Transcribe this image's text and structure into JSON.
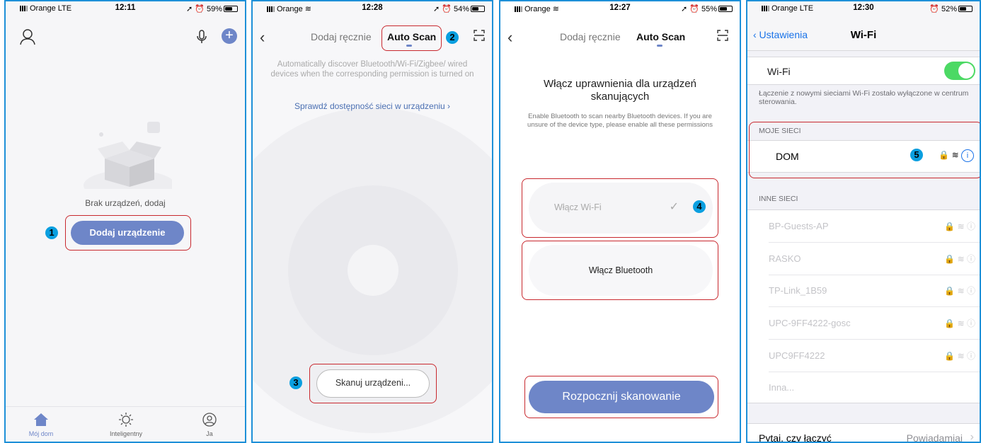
{
  "panel1": {
    "status": {
      "carrier": "Orange  LTE",
      "time": "12:11",
      "battery": "59%"
    },
    "empty_text": "Brak urządzeń, dodaj",
    "add_button": "Dodaj urządzenie",
    "marker": "1",
    "tabs": [
      {
        "label": "Mój dom",
        "icon": "home-icon"
      },
      {
        "label": "Inteligentny",
        "icon": "sun-icon"
      },
      {
        "label": "Ja",
        "icon": "user-icon"
      }
    ]
  },
  "panel2": {
    "status": {
      "carrier": "Orange",
      "time": "12:28",
      "battery": "54%"
    },
    "tab_manual": "Dodaj ręcznie",
    "tab_auto": "Auto Scan",
    "marker_tab": "2",
    "description": "Automatically discover Bluetooth/Wi-Fi/Zigbee/ wired devices when the corresponding permission is turned on",
    "link": "Sprawdź dostępność sieci w urządzeniu ›",
    "scan_button": "Skanuj urządzeni...",
    "marker_scan": "3"
  },
  "panel3": {
    "status": {
      "carrier": "Orange",
      "time": "12:27",
      "battery": "55%"
    },
    "tab_manual": "Dodaj ręcznie",
    "tab_auto": "Auto Scan",
    "title": "Włącz uprawnienia dla urządzeń skanujących",
    "description": "Enable Bluetooth to scan nearby Bluetooth devices. If you are unsure of the device type, please enable all these permissions",
    "wifi_option": "Włącz Wi-Fi",
    "marker_wifi": "4",
    "bluetooth_option": "Włącz Bluetooth",
    "start_button": "Rozpocznij skanowanie"
  },
  "panel4": {
    "status": {
      "carrier": "Orange  LTE",
      "time": "12:30",
      "battery": "52%"
    },
    "back": "‹ Ustawienia",
    "title": "Wi-Fi",
    "wifi_label": "Wi-Fi",
    "wifi_enabled": true,
    "note": "Łączenie z nowymi sieciami Wi-Fi zostało wyłączone w centrum sterowania.",
    "my_networks_header": "MOJE SIECI",
    "my_network": "DOM",
    "marker_network": "5",
    "other_networks_header": "INNE SIECI",
    "other_networks": [
      "BP-Guests-AP",
      "RASKO",
      "TP-Link_1B59",
      "UPC-9FF4222-gosc",
      "UPC9FF4222",
      "Inna..."
    ],
    "ask_label": "Pytaj, czy łączyć",
    "ask_value": "Powiadamiaj"
  }
}
